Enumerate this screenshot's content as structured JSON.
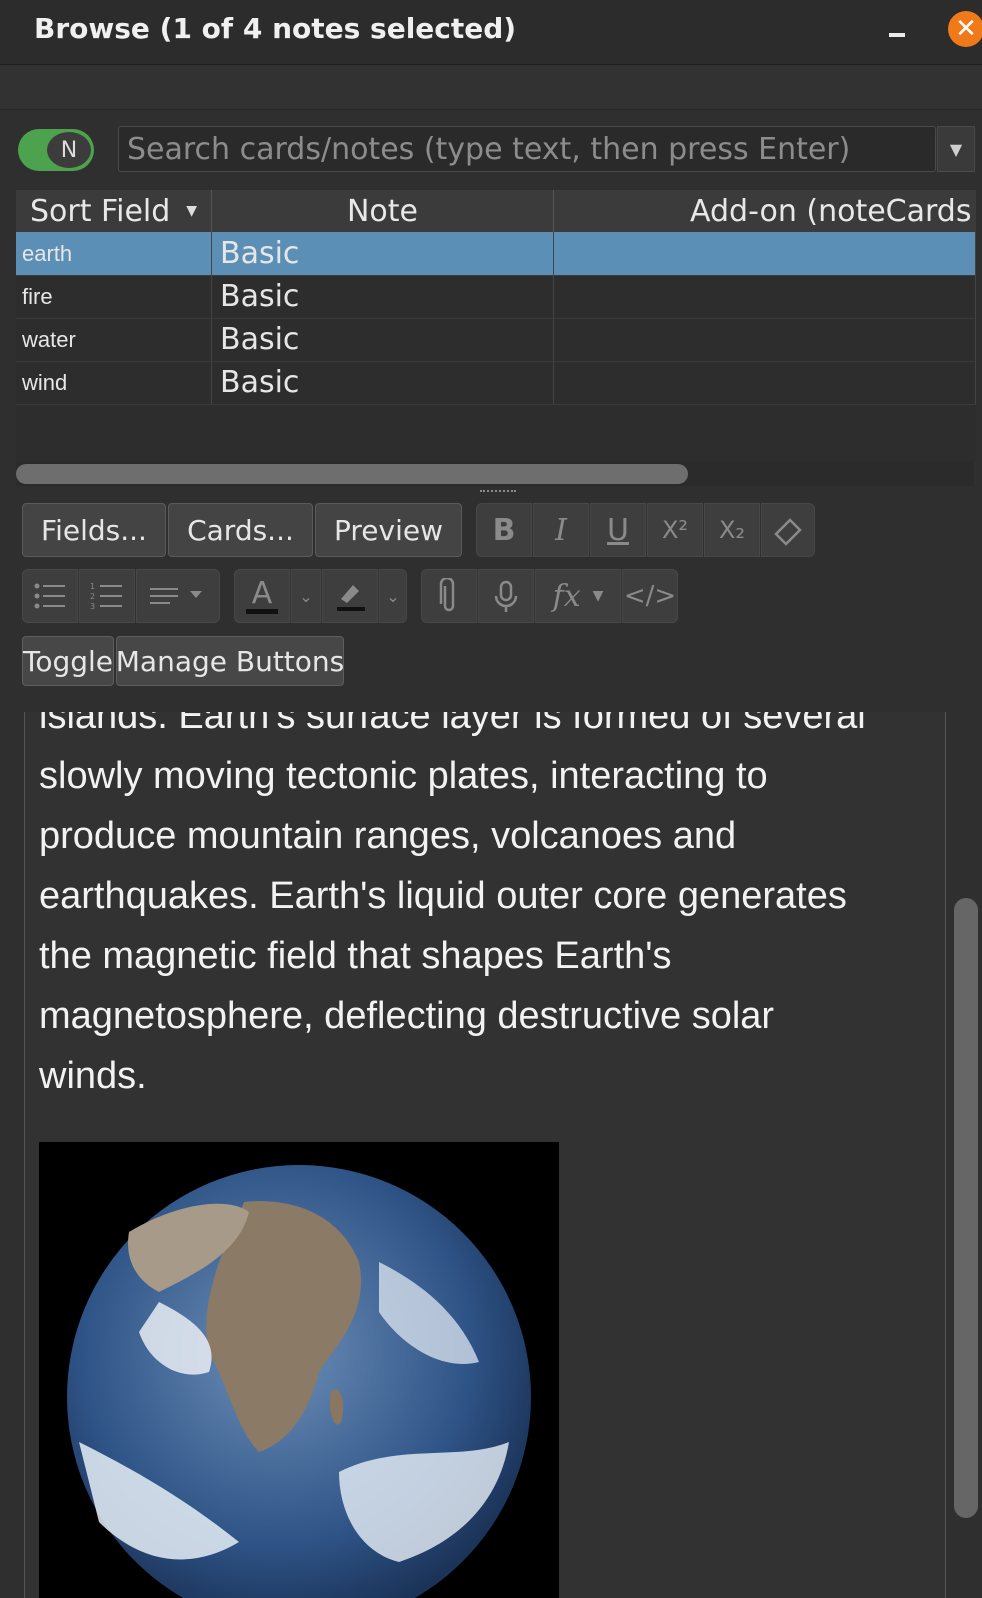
{
  "window": {
    "title": "Browse (1 of 4 notes selected)",
    "close_icon": "close-icon",
    "minimize_icon": "minimize-icon"
  },
  "search": {
    "toggle_label": "N",
    "placeholder": "Search cards/notes (type text, then press Enter)"
  },
  "table": {
    "headers": [
      "Sort Field",
      "Note",
      "Add-on (noteCards"
    ],
    "rows": [
      {
        "sort_field": "earth",
        "note": "Basic",
        "selected": true
      },
      {
        "sort_field": "fire",
        "note": "Basic",
        "selected": false
      },
      {
        "sort_field": "water",
        "note": "Basic",
        "selected": false
      },
      {
        "sort_field": "wind",
        "note": "Basic",
        "selected": false
      }
    ]
  },
  "editor_toolbar": {
    "fields_label": "Fields...",
    "cards_label": "Cards...",
    "preview_label": "Preview",
    "toggle_label": "Toggle",
    "manage_buttons_label": "Manage Buttons",
    "format_icons": [
      "bold-icon",
      "italic-icon",
      "underline-icon",
      "superscript-icon",
      "subscript-icon",
      "eraser-icon",
      "bullet-list-icon",
      "numbered-list-icon",
      "align-icon",
      "text-color-icon",
      "highlight-icon",
      "attach-icon",
      "microphone-icon",
      "function-icon",
      "html-code-icon"
    ],
    "bold": "B",
    "italic": "I",
    "underline": "U",
    "superscript": "X²",
    "subscript": "X₂",
    "text_color": "A",
    "function": "fx"
  },
  "editor": {
    "lines": [
      "islands. Earth's surface layer is formed of several",
      "slowly moving tectonic plates, interacting to",
      "produce mountain ranges, volcanoes and",
      "earthquakes. Earth's liquid outer core generates",
      "the magnetic field that shapes Earth's",
      "magnetosphere, deflecting destructive solar",
      "winds."
    ],
    "image": "earth-photo"
  }
}
